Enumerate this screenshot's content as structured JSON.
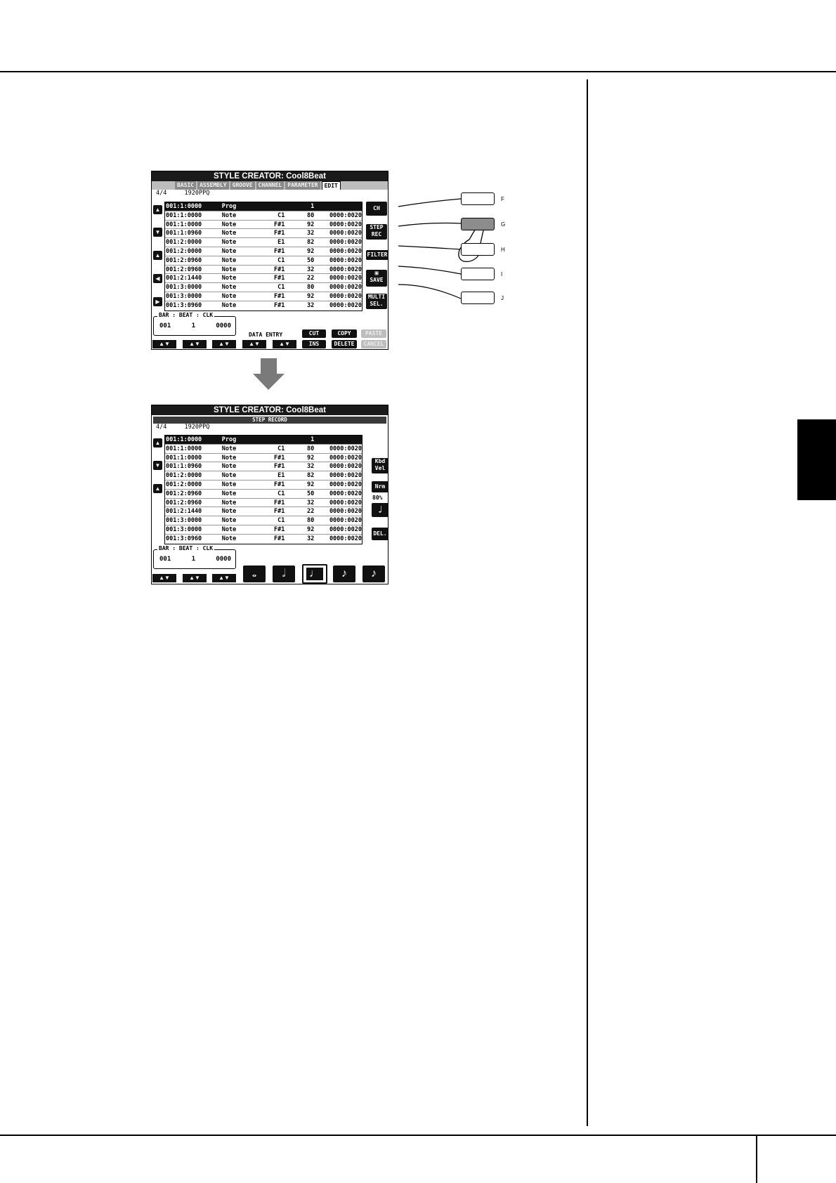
{
  "screen1": {
    "title": "STYLE CREATOR: Cool8Beat",
    "tabs": [
      "BASIC",
      "ASSEMBLY",
      "GROOVE",
      "CHANNEL",
      "PARAMETER",
      "EDIT"
    ],
    "active_tab": "EDIT",
    "time_signature": "4/4",
    "resolution": "1920PPQ",
    "rows": [
      {
        "time": "001:1:0000",
        "event": "Prog",
        "note": "",
        "vel": "1",
        "gate": ""
      },
      {
        "time": "001:1:0000",
        "event": "Note",
        "note": "C1",
        "vel": "80",
        "gate": "0000:0020"
      },
      {
        "time": "001:1:0000",
        "event": "Note",
        "note": "F#1",
        "vel": "92",
        "gate": "0000:0020"
      },
      {
        "time": "001:1:0960",
        "event": "Note",
        "note": "F#1",
        "vel": "32",
        "gate": "0000:0020"
      },
      {
        "time": "001:2:0000",
        "event": "Note",
        "note": "E1",
        "vel": "82",
        "gate": "0000:0020"
      },
      {
        "time": "001:2:0000",
        "event": "Note",
        "note": "F#1",
        "vel": "92",
        "gate": "0000:0020"
      },
      {
        "time": "001:2:0960",
        "event": "Note",
        "note": "C1",
        "vel": "50",
        "gate": "0000:0020"
      },
      {
        "time": "001:2:0960",
        "event": "Note",
        "note": "F#1",
        "vel": "32",
        "gate": "0000:0020"
      },
      {
        "time": "001:2:1440",
        "event": "Note",
        "note": "F#1",
        "vel": "22",
        "gate": "0000:0020"
      },
      {
        "time": "001:3:0000",
        "event": "Note",
        "note": "C1",
        "vel": "80",
        "gate": "0000:0020"
      },
      {
        "time": "001:3:0000",
        "event": "Note",
        "note": "F#1",
        "vel": "92",
        "gate": "0000:0020"
      },
      {
        "time": "001:3:0960",
        "event": "Note",
        "note": "F#1",
        "vel": "32",
        "gate": "0000:0020"
      }
    ],
    "position": {
      "label": "BAR : BEAT : CLK",
      "bar": "001",
      "beat": "1",
      "clk": "0000"
    },
    "data_entry_label": "DATA ENTRY",
    "right_softkeys": {
      "ch": "CH",
      "step_rec_1": "STEP",
      "step_rec_2": "REC",
      "filter": "FILTER",
      "save": "SAVE",
      "multi_sel_1": "MULTI",
      "multi_sel_2": "SEL."
    },
    "bottom_softkeys": {
      "cut": "CUT",
      "ins": "INS",
      "copy": "COPY",
      "delete": "DELETE",
      "paste": "PASTE",
      "cancel": "CANCEL"
    }
  },
  "hardware_buttons": [
    "F",
    "G",
    "H",
    "I",
    "J"
  ],
  "pressed_button": "G",
  "screen2": {
    "title": "STYLE CREATOR: Cool8Beat",
    "banner": "STEP RECORD",
    "time_signature": "4/4",
    "resolution": "1920PPQ",
    "rows": [
      {
        "time": "001:1:0000",
        "event": "Prog",
        "note": "",
        "vel": "1",
        "gate": ""
      },
      {
        "time": "001:1:0000",
        "event": "Note",
        "note": "C1",
        "vel": "80",
        "gate": "0000:0020"
      },
      {
        "time": "001:1:0000",
        "event": "Note",
        "note": "F#1",
        "vel": "92",
        "gate": "0000:0020"
      },
      {
        "time": "001:1:0960",
        "event": "Note",
        "note": "F#1",
        "vel": "32",
        "gate": "0000:0020"
      },
      {
        "time": "001:2:0000",
        "event": "Note",
        "note": "E1",
        "vel": "82",
        "gate": "0000:0020"
      },
      {
        "time": "001:2:0000",
        "event": "Note",
        "note": "F#1",
        "vel": "92",
        "gate": "0000:0020"
      },
      {
        "time": "001:2:0960",
        "event": "Note",
        "note": "C1",
        "vel": "50",
        "gate": "0000:0020"
      },
      {
        "time": "001:2:0960",
        "event": "Note",
        "note": "F#1",
        "vel": "32",
        "gate": "0000:0020"
      },
      {
        "time": "001:2:1440",
        "event": "Note",
        "note": "F#1",
        "vel": "22",
        "gate": "0000:0020"
      },
      {
        "time": "001:3:0000",
        "event": "Note",
        "note": "C1",
        "vel": "80",
        "gate": "0000:0020"
      },
      {
        "time": "001:3:0000",
        "event": "Note",
        "note": "F#1",
        "vel": "92",
        "gate": "0000:0020"
      },
      {
        "time": "001:3:0960",
        "event": "Note",
        "note": "F#1",
        "vel": "32",
        "gate": "0000:0020"
      }
    ],
    "position": {
      "label": "BAR : BEAT : CLK",
      "bar": "001",
      "beat": "1",
      "clk": "0000"
    },
    "side_labels": {
      "kbd_1": "Kbd",
      "kbd_2": "Vel",
      "nrm": "Nrm",
      "percent": "80%",
      "del": "DEL."
    },
    "note_keys": [
      "𝅝",
      "𝅗𝅥",
      "♩",
      "♪",
      "♪"
    ]
  }
}
